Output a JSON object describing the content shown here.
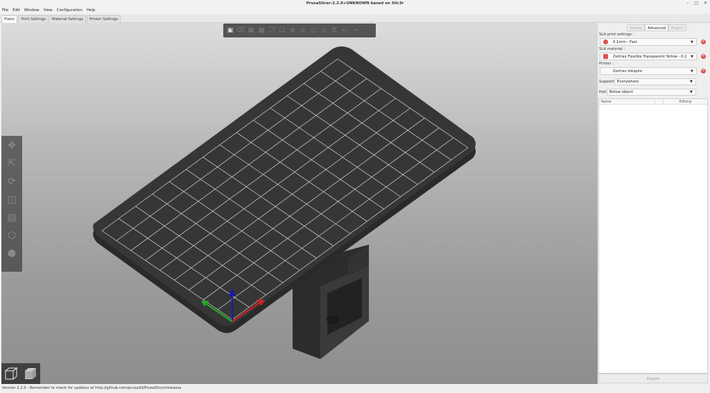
{
  "window": {
    "title": "PrusaSlicer-2.2.0+UNKNOWN based on Slic3r",
    "controls": [
      "–",
      "□",
      "✕"
    ]
  },
  "menu": [
    "File",
    "Edit",
    "Window",
    "View",
    "Configuration",
    "Help"
  ],
  "tabs": [
    "Plater",
    "Print Settings",
    "Material Settings",
    "Printer Settings"
  ],
  "sidebar": {
    "modes": [
      "Simple",
      "Advanced",
      "Expert"
    ],
    "print_settings_label": "SLA print settings :",
    "print_settings_value": "0.1mm - Fast",
    "material_label": "SLA material :",
    "material_value": "Zortrax Flexible Transparent Yellow - 0.1",
    "printer_label": "Printer :",
    "printer_value": "Zortrax Inkspire",
    "supports_label": "Supports:",
    "supports_value": "Everywhere",
    "pad_label": "Pad:",
    "pad_value": "Below object",
    "list_col_name": "Name",
    "list_col_editing": "Editing",
    "export_label": "Export"
  },
  "status": "Version 2.2.0 - Remember to check for updates at http://github.com/prusa3d/PrusaSlicer/releases",
  "colors": {
    "axis_x": "#cc2222",
    "axis_y": "#22aa22",
    "axis_z": "#1a1aaa",
    "bed": "#333333",
    "object": "#2b2b2b"
  }
}
